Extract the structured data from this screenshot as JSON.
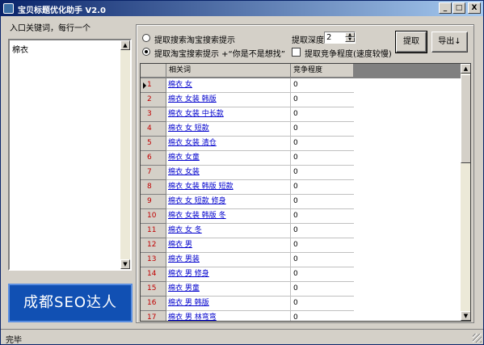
{
  "window": {
    "title": "宝贝标题优化助手 V2.0",
    "minimize": "_",
    "maximize": "□",
    "close": "X"
  },
  "left": {
    "label": "入口关键词，每行一个",
    "textarea_value": "棉衣",
    "banner": "成都SEO达人"
  },
  "options": {
    "radio1": "提取搜索淘宝搜索提示",
    "radio2": "提取淘宝搜索提示 +“你是不是想找”",
    "radio_selected": 2,
    "depth_label": "提取深度",
    "depth_value": "2",
    "compete_label": "提取竞争程度(速度较慢)",
    "compete_checked": false
  },
  "buttons": {
    "extract": "提取",
    "export": "导出↓"
  },
  "table": {
    "headers": [
      "",
      "相关词",
      "竞争程度"
    ],
    "rows": [
      {
        "n": "1",
        "kw": "棉衣 女",
        "c": "0"
      },
      {
        "n": "2",
        "kw": "棉衣 女装 韩版",
        "c": "0"
      },
      {
        "n": "3",
        "kw": "棉衣 女装 中长款",
        "c": "0"
      },
      {
        "n": "4",
        "kw": "棉衣 女 短款",
        "c": "0"
      },
      {
        "n": "5",
        "kw": "棉衣 女装 清仓",
        "c": "0"
      },
      {
        "n": "6",
        "kw": "棉衣 女童",
        "c": "0"
      },
      {
        "n": "7",
        "kw": "棉衣 女装",
        "c": "0"
      },
      {
        "n": "8",
        "kw": "棉衣 女装 韩版 短款",
        "c": "0"
      },
      {
        "n": "9",
        "kw": "棉衣 女 短款 修身",
        "c": "0"
      },
      {
        "n": "10",
        "kw": "棉衣 女装 韩版 冬",
        "c": "0"
      },
      {
        "n": "11",
        "kw": "棉衣 女 冬",
        "c": "0"
      },
      {
        "n": "12",
        "kw": "棉衣 男",
        "c": "0"
      },
      {
        "n": "13",
        "kw": "棉衣 男装",
        "c": "0"
      },
      {
        "n": "14",
        "kw": "棉衣 男 修身",
        "c": "0"
      },
      {
        "n": "15",
        "kw": "棉衣 男童",
        "c": "0"
      },
      {
        "n": "16",
        "kw": "棉衣 男 韩版",
        "c": "0"
      },
      {
        "n": "17",
        "kw": "棉衣 男 林弯弯",
        "c": "0"
      }
    ]
  },
  "status": {
    "text": "完毕"
  }
}
